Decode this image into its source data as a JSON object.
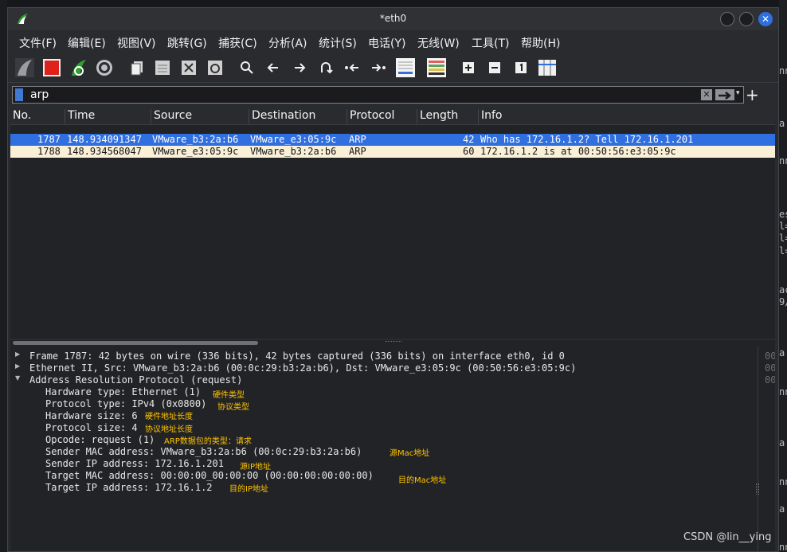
{
  "window": {
    "title": "*eth0",
    "close_glyph": "✕"
  },
  "menu": [
    "文件(F)",
    "编辑(E)",
    "视图(V)",
    "跳转(G)",
    "捕获(C)",
    "分析(A)",
    "统计(S)",
    "电话(Y)",
    "无线(W)",
    "工具(T)",
    "帮助(H)"
  ],
  "toolbar_icons": [
    "shark-fin-start-icon",
    "stop-square-icon",
    "restart-capture-icon",
    "capture-options-gear-icon",
    "open-file-icon",
    "save-file-icon",
    "close-file-icon",
    "reload-file-icon",
    "find-packet-icon",
    "go-back-icon",
    "go-forward-icon",
    "go-to-packet-icon",
    "first-packet-icon",
    "last-packet-icon",
    "auto-scroll-icon",
    "colorize-icon",
    "zoom-in-icon",
    "zoom-out-icon",
    "normal-size-icon",
    "resize-columns-icon"
  ],
  "filter": {
    "value": "arp",
    "clear_glyph": "✕",
    "dropdown_glyph": "▾",
    "add_glyph": "+"
  },
  "packet_list": {
    "columns": [
      "No.",
      "Time",
      "Source",
      "Destination",
      "Protocol",
      "Length",
      "Info"
    ],
    "rows": [
      {
        "no": "1787",
        "time": "148.934091347",
        "source": "VMware_b3:2a:b6",
        "destination": "VMware_e3:05:9c",
        "protocol": "ARP",
        "length": "42",
        "info": "Who has 172.16.1.2? Tell 172.16.1.201",
        "selected": true
      },
      {
        "no": "1788",
        "time": "148.934568047",
        "source": "VMware_e3:05:9c",
        "destination": "VMware_b3:2a:b6",
        "protocol": "ARP",
        "length": "60",
        "info": "172.16.1.2 is at 00:50:56:e3:05:9c",
        "selected": false
      }
    ]
  },
  "details": {
    "frame": "Frame 1787: 42 bytes on wire (336 bits), 42 bytes captured (336 bits) on interface eth0, id 0",
    "ethernet": "Ethernet II, Src: VMware_b3:2a:b6 (00:0c:29:b3:2a:b6), Dst: VMware_e3:05:9c (00:50:56:e3:05:9c)",
    "arp": "Address Resolution Protocol (request)",
    "fields": [
      {
        "text": "Hardware type: Ethernet (1)",
        "note": "硬件类型"
      },
      {
        "text": "Protocol type: IPv4 (0x0800)",
        "note": "协议类型"
      },
      {
        "text": "Hardware size: 6",
        "note": "硬件地址长度"
      },
      {
        "text": "Protocol size: 4",
        "note": "协议地址长度"
      },
      {
        "text": "Opcode: request (1)",
        "note": "ARP数据包的类型：请求"
      },
      {
        "text": "Sender MAC address: VMware_b3:2a:b6 (00:0c:29:b3:2a:b6)",
        "note": "源Mac地址"
      },
      {
        "text": "Sender IP address: 172.16.1.201",
        "note": "源IP地址"
      },
      {
        "text": "Target MAC address: 00:00:00_00:00:00 (00:00:00:00:00:00)",
        "note": "目的Mac地址"
      },
      {
        "text": "Target IP address: 172.16.1.2",
        "note": "目的IP地址"
      }
    ]
  },
  "bytes_pane": [
    "00",
    "00",
    "00"
  ],
  "background_text": [
    "nn",
    "a",
    "nn",
    "es",
    "l=",
    "l=",
    "l=",
    "ac",
    "9/",
    "a",
    "nn",
    "a",
    "nn",
    "a",
    "nn"
  ],
  "watermark": "CSDN @lin__ying",
  "colors": {
    "selected_row": "#2f6fe0",
    "arp_row": "#faf0d7",
    "annotation": "#ffc400",
    "stop_button": "#e0201a",
    "capture_green": "#2fa02f"
  }
}
